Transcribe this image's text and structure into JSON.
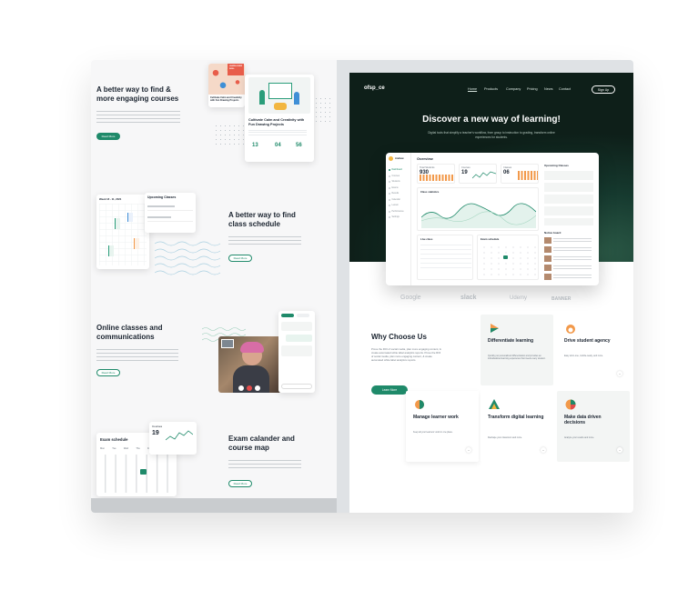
{
  "left": {
    "s1": {
      "title": "A better way to find & more engaging courses",
      "button": "Read More"
    },
    "s1_card": {
      "tag": "LEARN A NEW SKILL",
      "title": "Cultivate Calm and Creativity with Fun Drawing Projects",
      "stats": [
        "13",
        "04",
        "56"
      ]
    },
    "s1_small": {
      "title": "Cultivate Calm and Creativity with Fun Drawing Projects"
    },
    "s2": {
      "title": "A better way to find class schedule",
      "button": "Read More"
    },
    "s2_card": {
      "title": "Upcoming Classes",
      "week": "Week 18 - 11, 2021"
    },
    "s3": {
      "title": "Online classes and communications",
      "button": "Read More"
    },
    "s4": {
      "title": "Exam calander and course map",
      "button": "Read More"
    },
    "s4_cal": {
      "title": "Exam schedule",
      "days": [
        "Mon",
        "Tue",
        "Wed",
        "Thu",
        "Fri",
        "Sat",
        "Sun"
      ]
    },
    "s4_course": {
      "title": "Courses",
      "value": "19"
    }
  },
  "right": {
    "nav": {
      "logo": "ofsp_ce",
      "links": [
        "Home",
        "Products",
        "Company",
        "Pricing",
        "News",
        "Contact"
      ],
      "signup": "Sign Up"
    },
    "hero": {
      "title": "Discover a new way of learning!",
      "subtitle": "Digital tools that simplify a teacher's workflow, from group to instruction to grading, transform online experiences for students."
    },
    "dashboard": {
      "title": "Overview",
      "user": "Andrew",
      "sidebar": [
        "Dashboard",
        "Courses",
        "Students",
        "Exams",
        "Results",
        "Calendar",
        "Lesson",
        "Performance",
        "Settings"
      ],
      "stats": [
        {
          "label": "Total Students",
          "value": "930"
        },
        {
          "label": "Courses",
          "value": "19"
        },
        {
          "label": "Classes",
          "value": "06"
        }
      ],
      "chart_label": "Class statistics",
      "live_class": "Live class",
      "exam": "Exam schedule",
      "upcoming": "Upcoming Classes",
      "notice": "Notice board"
    },
    "logos": [
      "Google",
      "slack",
      "Udemy",
      "BANNER"
    ],
    "why": {
      "title": "Why Choose Us",
      "text": "Prove the ROI of social media, plan more engaging content, & create automated white label analytics reports. Prove the ROI of social media, plan more engaging content, & create automated white label analytics reports.",
      "button": "Learn More"
    },
    "features": [
      {
        "title": "Differentiate learning",
        "text": "Quickly put personalized differentiation and provides an individualized learning experience that meets every student."
      },
      {
        "title": "Drive student agency",
        "text": "Easy all-in-one, mobile-ready, and more."
      },
      {
        "title": "Manage learner work",
        "text": "Keep all your learners' work in one place."
      },
      {
        "title": "Transform digital learning",
        "text": "Reshape your classroom and more."
      },
      {
        "title": "Make data driven decisions",
        "text": "Analyze your results and more."
      }
    ]
  }
}
